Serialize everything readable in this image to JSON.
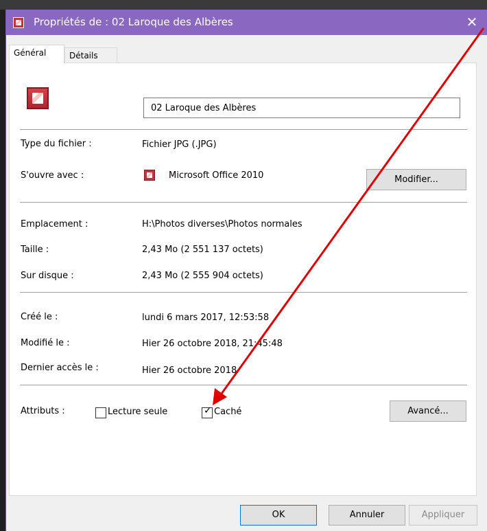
{
  "window": {
    "title": "Propriétés de : 02 Laroque des Albères",
    "close_glyph": "✕",
    "icon": "jpg-file-icon"
  },
  "tabs": [
    {
      "label": "Général",
      "active": true
    },
    {
      "label": "Détails",
      "active": false
    }
  ],
  "file": {
    "name": "02 Laroque des Albères",
    "icon": "jpg-file-icon"
  },
  "info": {
    "type_label": "Type du fichier :",
    "type_value": "Fichier JPG (.JPG)",
    "opens_label": "S'ouvre avec :",
    "opens_value": "Microsoft Office 2010",
    "opens_icon": "office-picture-icon",
    "change_button": "Modifier...",
    "location_label": "Emplacement :",
    "location_value": "H:\\Photos diverses\\Photos normales",
    "size_label": "Taille :",
    "size_value": "2,43 Mo (2 551 137 octets)",
    "disk_label": "Sur disque :",
    "disk_value": "2,43 Mo (2 555 904 octets)",
    "created_label": "Créé le :",
    "created_value": "lundi 6 mars 2017, 12:53:58",
    "modified_label": "Modifié le :",
    "modified_value": "Hier 26 octobre 2018, 21:45:48",
    "accessed_label": "Dernier accès le :",
    "accessed_value": "Hier 26 octobre 2018"
  },
  "attributes": {
    "label": "Attributs :",
    "readonly_label": "Lecture seule",
    "readonly_checked": false,
    "hidden_label": "Caché",
    "hidden_checked": true,
    "advanced_button": "Avancé..."
  },
  "footer": {
    "ok": "OK",
    "cancel": "Annuler",
    "apply": "Appliquer"
  },
  "colors": {
    "titlebar": "#8a67c0",
    "annotation_arrow": "#e00000",
    "focus_border": "#0078d7"
  }
}
